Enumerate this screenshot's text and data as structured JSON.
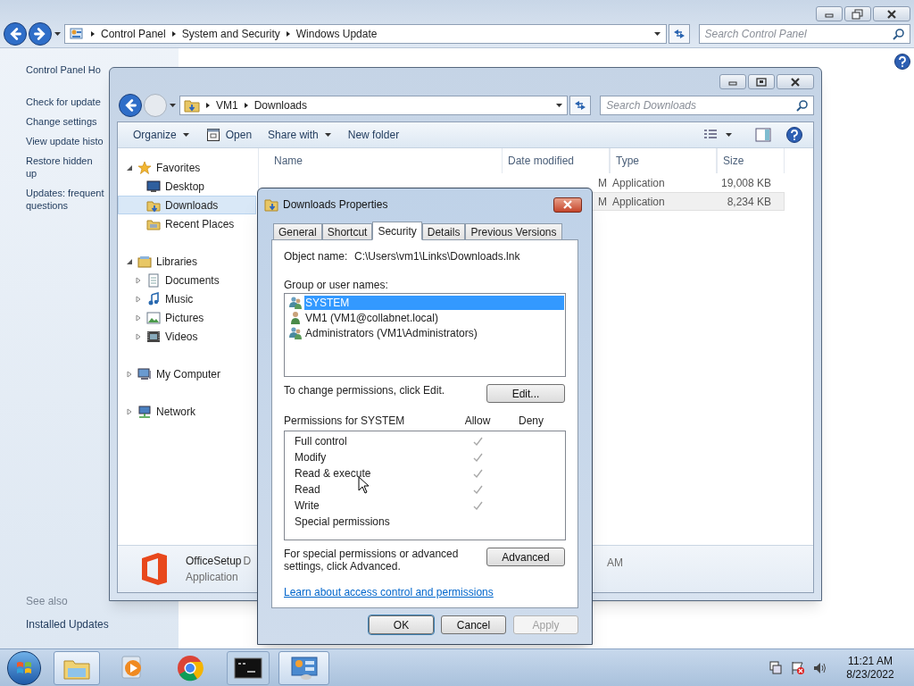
{
  "control_panel": {
    "breadcrumb": [
      "Control Panel",
      "System and Security",
      "Windows Update"
    ],
    "search": {
      "placeholder": "Search Control Panel"
    },
    "sidebar_title": "Control Panel Ho",
    "sidebar_links": [
      "Check for update",
      "Change settings",
      "View update histo",
      "Restore hidden up",
      "Updates: frequent questions"
    ],
    "see_also_heading": "See also",
    "see_also_links": [
      "Installed Updates"
    ]
  },
  "explorer": {
    "breadcrumb": [
      "VM1",
      "Downloads"
    ],
    "search": {
      "placeholder": "Search Downloads"
    },
    "toolbar": [
      {
        "label": "Organize",
        "kind": "menu"
      },
      {
        "label": "Open",
        "kind": "icon"
      },
      {
        "label": "Share with",
        "kind": "menu"
      },
      {
        "label": "New folder",
        "kind": "plain"
      }
    ],
    "nav_tree": [
      {
        "label": "Favorites",
        "kind": "star",
        "expanded": true,
        "selected": false,
        "children": [
          {
            "label": "Desktop",
            "kind": "desktop",
            "selected": false
          },
          {
            "label": "Downloads",
            "kind": "downloads",
            "selected": true
          },
          {
            "label": "Recent Places",
            "kind": "recent",
            "selected": false
          }
        ]
      },
      {
        "label": "Libraries",
        "kind": "library",
        "expanded": true,
        "selected": false,
        "children": [
          {
            "label": "Documents",
            "kind": "documents",
            "expanded": false,
            "selected": false
          },
          {
            "label": "Music",
            "kind": "music",
            "expanded": false,
            "selected": false
          },
          {
            "label": "Pictures",
            "kind": "pictures",
            "expanded": false,
            "selected": false
          },
          {
            "label": "Videos",
            "kind": "videos",
            "expanded": false,
            "selected": false
          }
        ]
      },
      {
        "label": "My Computer",
        "kind": "computer",
        "expanded": false,
        "selected": false
      },
      {
        "label": "Network",
        "kind": "network",
        "expanded": false,
        "selected": false
      }
    ],
    "columns": [
      "Name",
      "Date modified",
      "Type",
      "Size"
    ],
    "files": [
      {
        "date": "M",
        "type": "Application",
        "size": "19,008 KB",
        "selected": false
      },
      {
        "date": "M",
        "type": "Application",
        "size": "8,234 KB",
        "selected": true
      }
    ],
    "details": {
      "name": "OfficeSetup",
      "name_fragment": "D",
      "type": "Application",
      "date_fragment": "AM"
    }
  },
  "dialog": {
    "title": "Downloads Properties",
    "tabs": [
      {
        "label": "General",
        "selected": false
      },
      {
        "label": "Shortcut",
        "selected": false
      },
      {
        "label": "Security",
        "selected": true
      },
      {
        "label": "Details",
        "selected": false
      },
      {
        "label": "Previous Versions",
        "selected": false
      }
    ],
    "object_label": "Object name:",
    "object_value": "C:\\Users\\vm1\\Links\\Downloads.lnk",
    "group_label": "Group or user names:",
    "users": [
      {
        "name": "SYSTEM",
        "kind": "group",
        "selected": true
      },
      {
        "name": "VM1 (VM1@collabnet.local)",
        "kind": "user",
        "selected": false
      },
      {
        "name": "Administrators (VM1\\Administrators)",
        "kind": "group",
        "selected": false
      }
    ],
    "edit_note": "To change permissions, click Edit.",
    "edit_button": "Edit...",
    "permissions_label": "Permissions for SYSTEM",
    "allow_heading": "Allow",
    "deny_heading": "Deny",
    "permissions": [
      {
        "name": "Full control",
        "allow": true,
        "deny": false
      },
      {
        "name": "Modify",
        "allow": true,
        "deny": false
      },
      {
        "name": "Read & execute",
        "allow": true,
        "deny": false
      },
      {
        "name": "Read",
        "allow": true,
        "deny": false
      },
      {
        "name": "Write",
        "allow": true,
        "deny": false
      },
      {
        "name": "Special permissions",
        "allow": false,
        "deny": false
      }
    ],
    "advanced_note": "For special permissions or advanced settings, click Advanced.",
    "advanced_button": "Advanced",
    "link": "Learn about access control and permissions",
    "buttons": [
      {
        "label": "OK",
        "kind": "default",
        "disabled": false
      },
      {
        "label": "Cancel",
        "kind": "normal",
        "disabled": false
      },
      {
        "label": "Apply",
        "kind": "normal",
        "disabled": true
      }
    ]
  },
  "taskbar": {
    "items": [
      {
        "kind": "explorer",
        "active": true
      },
      {
        "kind": "media",
        "active": false
      },
      {
        "kind": "chrome",
        "active": false
      },
      {
        "kind": "cmd",
        "active": false
      },
      {
        "kind": "control",
        "active": true
      }
    ],
    "clock": {
      "time": "11:21 AM",
      "date": "8/23/2022"
    }
  }
}
